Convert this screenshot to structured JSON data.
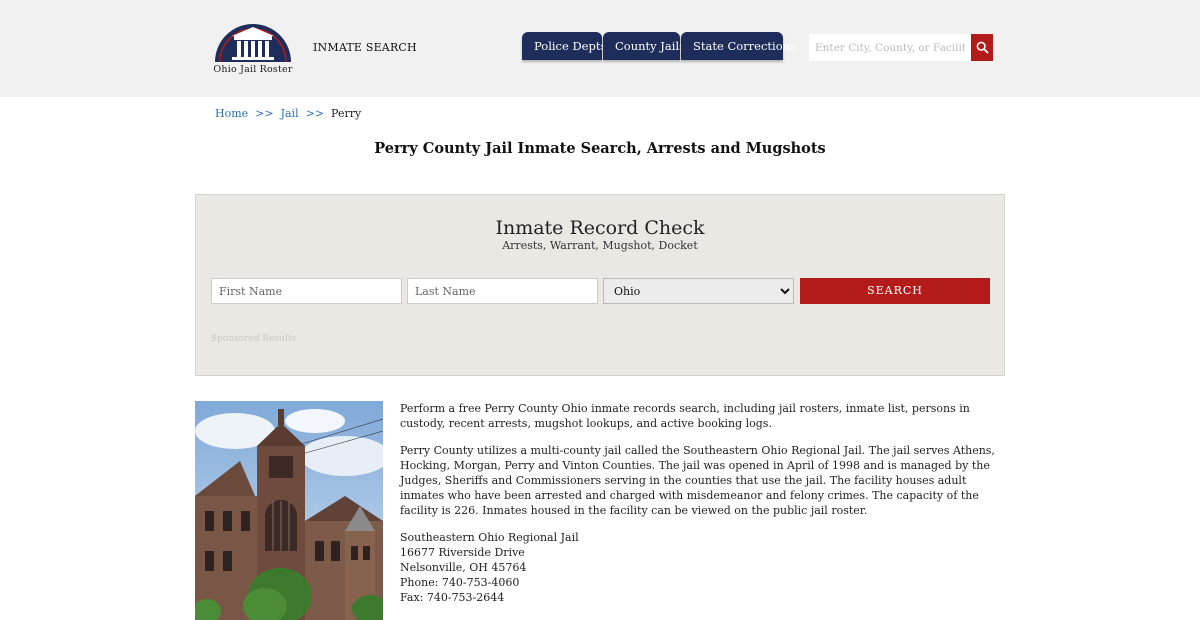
{
  "header": {
    "logo_text": "Ohio Jail Roster",
    "inmate_search": "INMATE SEARCH",
    "nav": [
      "Police Depts",
      "County Jails",
      "State Corrections"
    ],
    "search_placeholder": "Enter City, County, or Facility",
    "icons": {
      "search": "magnifier-icon",
      "logo": "courthouse-dome-icon"
    },
    "colors": {
      "nav": "#1f2d5a",
      "accent": "#b31b1b"
    }
  },
  "breadcrumb": {
    "home": "Home",
    "sep": ">>",
    "jail": "Jail",
    "current": "Perry"
  },
  "page_title": "Perry County Jail Inmate Search, Arrests and Mugshots",
  "record_check": {
    "title": "Inmate Record Check",
    "subtitle": "Arrests, Warrant, Mugshot, Docket",
    "first_placeholder": "First Name",
    "last_placeholder": "Last Name",
    "state_selected": "Ohio",
    "search_label": "SEARCH",
    "sponsored": "Sponsored Results"
  },
  "content": {
    "p1": "Perform a free Perry County Ohio inmate records search, including jail rosters, inmate list, persons in custody, recent arrests, mugshot lookups, and active booking logs.",
    "p2": "Perry County utilizes a multi-county jail called the Southeastern Ohio Regional Jail. The jail serves Athens, Hocking, Morgan, Perry and Vinton Counties. The jail was opened in April of 1998 and is managed by the Judges, Sheriffs and Commissioners serving in the counties that use the jail. The facility houses adult inmates who have been arrested and charged with misdemeanor and felony crimes. The capacity of the facility is 226. Inmates housed in the facility can be viewed on the public jail roster.",
    "address": {
      "name": "Southeastern Ohio Regional Jail",
      "street": "16677 Riverside Drive",
      "city": "Nelsonville, OH 45764",
      "phone": "Phone: 740-753-4060",
      "fax": "Fax: 740-753-2644"
    }
  }
}
